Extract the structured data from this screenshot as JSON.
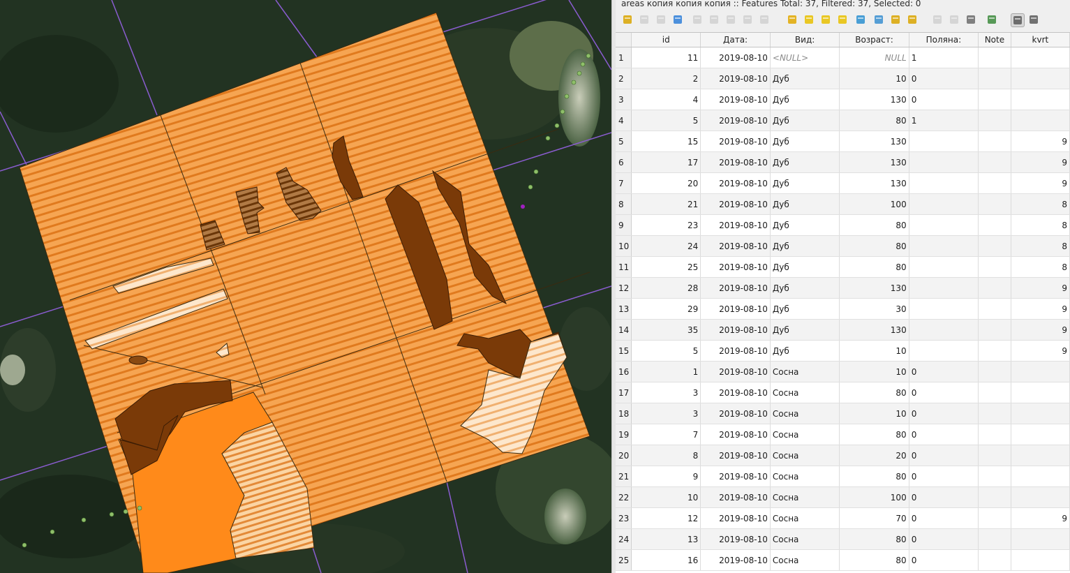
{
  "attribute_table": {
    "title": "areas копия копия копия :: Features Total: 37, Filtered: 37, Selected: 0",
    "columns": [
      "id",
      "Дата:",
      "Вид:",
      "Возраст:",
      "Поляна:",
      "Note",
      "kvrt"
    ],
    "rows": [
      {
        "n": "1",
        "id": "11",
        "date": "2019-08-10",
        "vid": "<NULL>",
        "age": "NULL",
        "polyana": "1",
        "note": "",
        "kvrt": ""
      },
      {
        "n": "2",
        "id": "2",
        "date": "2019-08-10",
        "vid": "Дуб",
        "age": "10",
        "polyana": "0",
        "note": "",
        "kvrt": ""
      },
      {
        "n": "3",
        "id": "4",
        "date": "2019-08-10",
        "vid": "Дуб",
        "age": "130",
        "polyana": "0",
        "note": "",
        "kvrt": ""
      },
      {
        "n": "4",
        "id": "5",
        "date": "2019-08-10",
        "vid": "Дуб",
        "age": "80",
        "polyana": "1",
        "note": "",
        "kvrt": ""
      },
      {
        "n": "5",
        "id": "15",
        "date": "2019-08-10",
        "vid": "Дуб",
        "age": "130",
        "polyana": "",
        "note": "",
        "kvrt": "9"
      },
      {
        "n": "6",
        "id": "17",
        "date": "2019-08-10",
        "vid": "Дуб",
        "age": "130",
        "polyana": "",
        "note": "",
        "kvrt": "9"
      },
      {
        "n": "7",
        "id": "20",
        "date": "2019-08-10",
        "vid": "Дуб",
        "age": "130",
        "polyana": "",
        "note": "",
        "kvrt": "9"
      },
      {
        "n": "8",
        "id": "21",
        "date": "2019-08-10",
        "vid": "Дуб",
        "age": "100",
        "polyana": "",
        "note": "",
        "kvrt": "8"
      },
      {
        "n": "9",
        "id": "23",
        "date": "2019-08-10",
        "vid": "Дуб",
        "age": "80",
        "polyana": "",
        "note": "",
        "kvrt": "8"
      },
      {
        "n": "10",
        "id": "24",
        "date": "2019-08-10",
        "vid": "Дуб",
        "age": "80",
        "polyana": "",
        "note": "",
        "kvrt": "8"
      },
      {
        "n": "11",
        "id": "25",
        "date": "2019-08-10",
        "vid": "Дуб",
        "age": "80",
        "polyana": "",
        "note": "",
        "kvrt": "8"
      },
      {
        "n": "12",
        "id": "28",
        "date": "2019-08-10",
        "vid": "Дуб",
        "age": "130",
        "polyana": "",
        "note": "",
        "kvrt": "9"
      },
      {
        "n": "13",
        "id": "29",
        "date": "2019-08-10",
        "vid": "Дуб",
        "age": "30",
        "polyana": "",
        "note": "",
        "kvrt": "9"
      },
      {
        "n": "14",
        "id": "35",
        "date": "2019-08-10",
        "vid": "Дуб",
        "age": "130",
        "polyana": "",
        "note": "",
        "kvrt": "9"
      },
      {
        "n": "15",
        "id": "5",
        "date": "2019-08-10",
        "vid": "Дуб",
        "age": "10",
        "polyana": "",
        "note": "",
        "kvrt": "9"
      },
      {
        "n": "16",
        "id": "1",
        "date": "2019-08-10",
        "vid": "Сосна",
        "age": "10",
        "polyana": "0",
        "note": "",
        "kvrt": ""
      },
      {
        "n": "17",
        "id": "3",
        "date": "2019-08-10",
        "vid": "Сосна",
        "age": "80",
        "polyana": "0",
        "note": "",
        "kvrt": ""
      },
      {
        "n": "18",
        "id": "3",
        "date": "2019-08-10",
        "vid": "Сосна",
        "age": "10",
        "polyana": "0",
        "note": "",
        "kvrt": ""
      },
      {
        "n": "19",
        "id": "7",
        "date": "2019-08-10",
        "vid": "Сосна",
        "age": "80",
        "polyana": "0",
        "note": "",
        "kvrt": ""
      },
      {
        "n": "20",
        "id": "8",
        "date": "2019-08-10",
        "vid": "Сосна",
        "age": "20",
        "polyana": "0",
        "note": "",
        "kvrt": ""
      },
      {
        "n": "21",
        "id": "9",
        "date": "2019-08-10",
        "vid": "Сосна",
        "age": "80",
        "polyana": "0",
        "note": "",
        "kvrt": ""
      },
      {
        "n": "22",
        "id": "10",
        "date": "2019-08-10",
        "vid": "Сосна",
        "age": "100",
        "polyana": "0",
        "note": "",
        "kvrt": ""
      },
      {
        "n": "23",
        "id": "12",
        "date": "2019-08-10",
        "vid": "Сосна",
        "age": "70",
        "polyana": "0",
        "note": "",
        "kvrt": "9"
      },
      {
        "n": "24",
        "id": "13",
        "date": "2019-08-10",
        "vid": "Сосна",
        "age": "80",
        "polyana": "0",
        "note": "",
        "kvrt": ""
      },
      {
        "n": "25",
        "id": "16",
        "date": "2019-08-10",
        "vid": "Сосна",
        "age": "80",
        "polyana": "0",
        "note": "",
        "kvrt": ""
      }
    ]
  },
  "toolbar": {
    "buttons": [
      {
        "name": "toggle-editing-icon",
        "color": "#d9a400",
        "enabled": true
      },
      {
        "name": "toggle-multi-edit-icon",
        "color": "#999999",
        "enabled": false
      },
      {
        "name": "save-edits-icon",
        "color": "#999999",
        "enabled": false
      },
      {
        "name": "reload-table-icon",
        "color": "#2f7fd8",
        "enabled": true
      },
      {
        "name": "add-feature-icon",
        "color": "#999999",
        "enabled": false
      },
      {
        "name": "delete-selected-icon",
        "color": "#999999",
        "enabled": false
      },
      {
        "name": "cut-icon",
        "color": "#999999",
        "enabled": false
      },
      {
        "name": "copy-icon",
        "color": "#999999",
        "enabled": false
      },
      {
        "name": "paste-icon",
        "color": "#999999",
        "enabled": false
      },
      {
        "name": "select-by-expression-icon",
        "color": "#e0a800",
        "enabled": true
      },
      {
        "name": "select-all-icon",
        "color": "#e8c000",
        "enabled": true
      },
      {
        "name": "invert-selection-icon",
        "color": "#e8c000",
        "enabled": true
      },
      {
        "name": "deselect-all-icon",
        "color": "#e8c000",
        "enabled": true
      },
      {
        "name": "filter-select-icon",
        "color": "#2a8fd0",
        "enabled": true
      },
      {
        "name": "move-selection-to-top-icon",
        "color": "#3a8fd0",
        "enabled": true
      },
      {
        "name": "pan-to-selected-icon",
        "color": "#d9a400",
        "enabled": true
      },
      {
        "name": "zoom-to-selected-icon",
        "color": "#d9a400",
        "enabled": true
      },
      {
        "name": "new-field-icon",
        "color": "#999999",
        "enabled": false
      },
      {
        "name": "delete-field-icon",
        "color": "#999999",
        "enabled": false
      },
      {
        "name": "field-calculator-icon",
        "color": "#6b6b6b",
        "enabled": true
      },
      {
        "name": "conditional-formatting-icon",
        "color": "#3c8a3c",
        "enabled": true
      },
      {
        "name": "dock-table-icon",
        "color": "#5a5a5a",
        "enabled": true
      },
      {
        "name": "actions-icon",
        "color": "#5a5a5a",
        "enabled": true
      }
    ]
  },
  "colors": {
    "forest": "#1f2d1f",
    "quarter_orange": "#f4a04c",
    "hatch_orange": "#e07a1e",
    "oak_brown": "#7a3a08",
    "solid_orange": "#ff8a1a",
    "light_hatch": "#fcd9ae",
    "grid_purple": "#8a5cd0"
  }
}
